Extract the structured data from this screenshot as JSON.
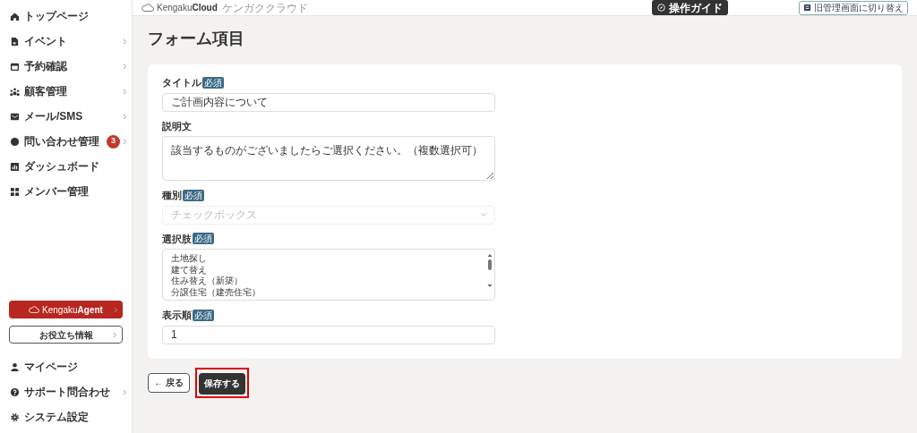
{
  "sidebar": {
    "items": [
      {
        "label": "トップページ",
        "chevron": false
      },
      {
        "label": "イベント",
        "chevron": true
      },
      {
        "label": "予約確認",
        "chevron": true
      },
      {
        "label": "顧客管理",
        "chevron": true
      },
      {
        "label": "メール/SMS",
        "chevron": true
      },
      {
        "label": "問い合わせ管理",
        "chevron": true,
        "badge": "3"
      },
      {
        "label": "ダッシュボード",
        "chevron": false
      },
      {
        "label": "メンバー管理",
        "chevron": false
      }
    ],
    "agent_button": {
      "brand": "Kengaku",
      "brand_bold": "Agent"
    },
    "info_button": "お役立ち情報",
    "bottom_items": [
      {
        "label": "マイページ",
        "chevron": false
      },
      {
        "label": "サポート問合わせ",
        "chevron": true
      },
      {
        "label": "システム設定",
        "chevron": false
      }
    ]
  },
  "header": {
    "logo": "Kengaku",
    "logo_bold": "Cloud",
    "tagline": "ケンガククラウド",
    "guide_button": "操作ガイド",
    "switch_button": "旧管理画面に切り替え"
  },
  "page_title": "フォーム項目",
  "form": {
    "fields": [
      {
        "kind": "input",
        "label": "タイトル",
        "badge": "必須",
        "value": "ご計画内容について"
      },
      {
        "kind": "textarea",
        "label": "説明文",
        "value": "該当するものがございましたらご選択ください。（複数選択可）"
      },
      {
        "kind": "select",
        "label": "種別",
        "badge": "必須",
        "value": "チェックボックス",
        "disabled": true
      },
      {
        "kind": "list",
        "label": "選択肢",
        "badge": "必須",
        "lines": [
          "土地探し",
          "建て替え",
          "住み替え（新築）",
          "分譲住宅（建売住宅）"
        ]
      },
      {
        "kind": "input",
        "label": "表示順",
        "badge": "必須",
        "value": "1"
      }
    ]
  },
  "actions": {
    "back_button": "← 戻る",
    "save_button": {
      "label": "保存する",
      "highlighted": true
    }
  }
}
